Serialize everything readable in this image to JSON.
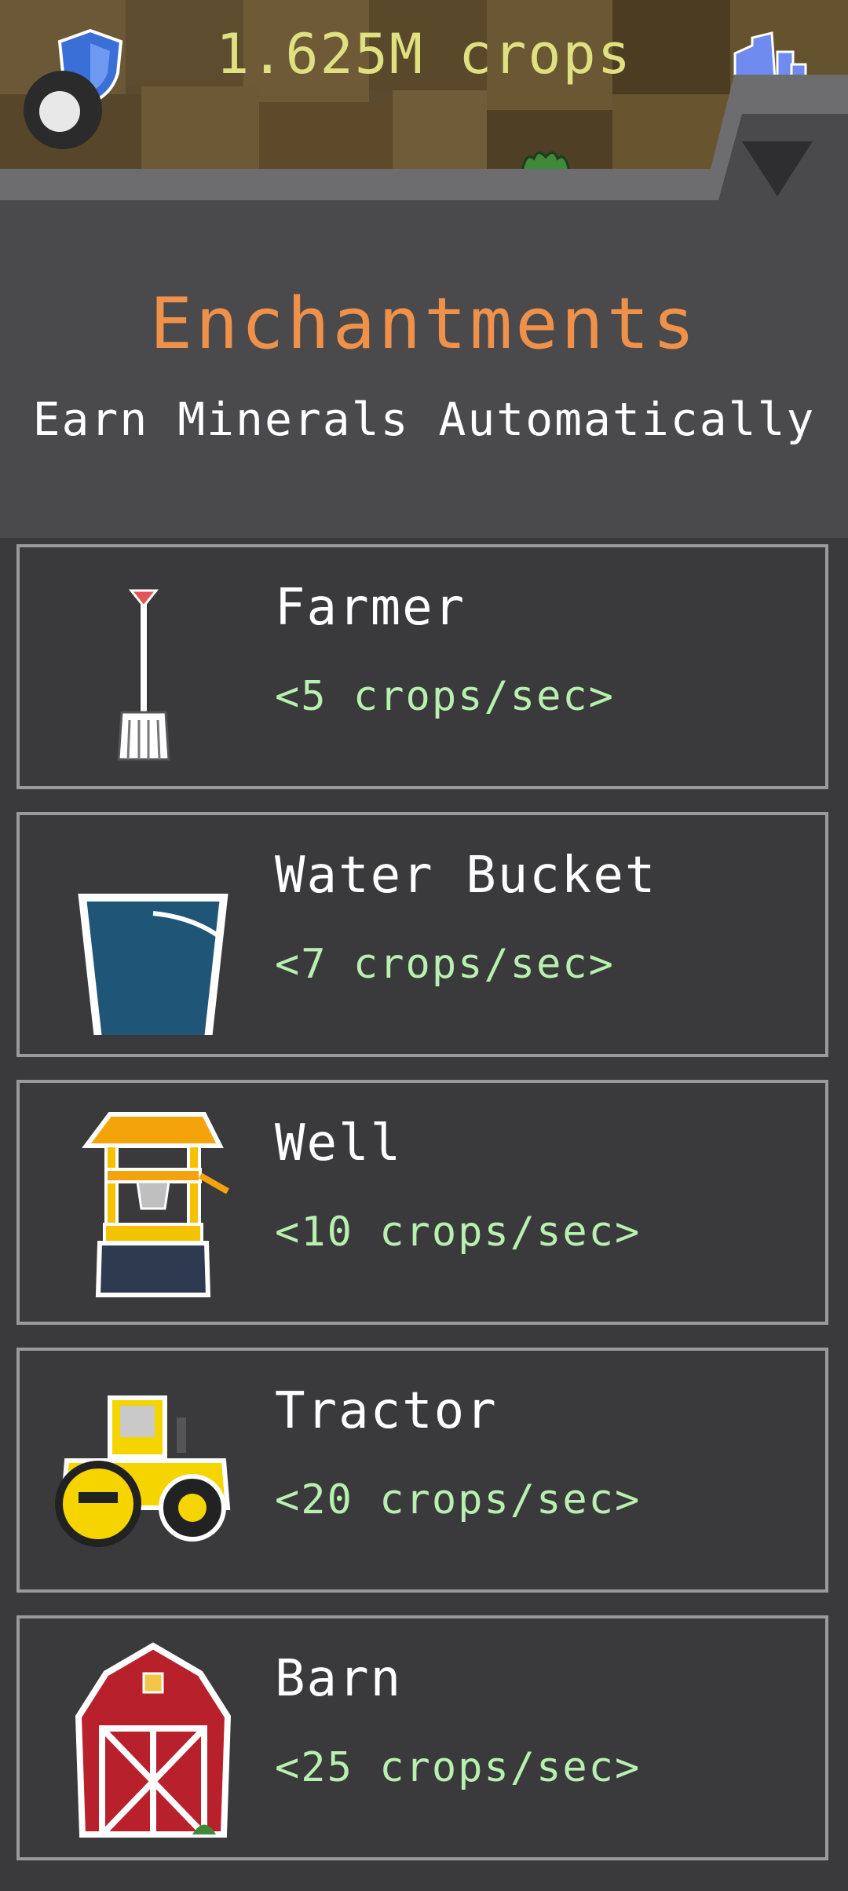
{
  "header": {
    "crop_counter": "1.625M crops",
    "shield_icon": "shield-icon",
    "stats_icon": "stats-icon",
    "collapse_icon": "triangle-down-icon"
  },
  "panel": {
    "title": "Enchantments",
    "subtitle": "Earn Minerals Automatically"
  },
  "items": [
    {
      "name": "Farmer",
      "rate": "<5 crops/sec>",
      "icon": "pitchfork-icon"
    },
    {
      "name": "Water Bucket",
      "rate": "<7 crops/sec>",
      "icon": "bucket-icon"
    },
    {
      "name": "Well",
      "rate": "<10 crops/sec>",
      "icon": "well-icon"
    },
    {
      "name": "Tractor",
      "rate": "<20 crops/sec>",
      "icon": "tractor-icon"
    },
    {
      "name": "Barn",
      "rate": "<25 crops/sec>",
      "icon": "barn-icon"
    }
  ],
  "colors": {
    "title": "#f0914a",
    "rate": "#b8f0b0",
    "counter": "#dfe07f",
    "panel": "#4a494c",
    "background": "#3a393b"
  }
}
